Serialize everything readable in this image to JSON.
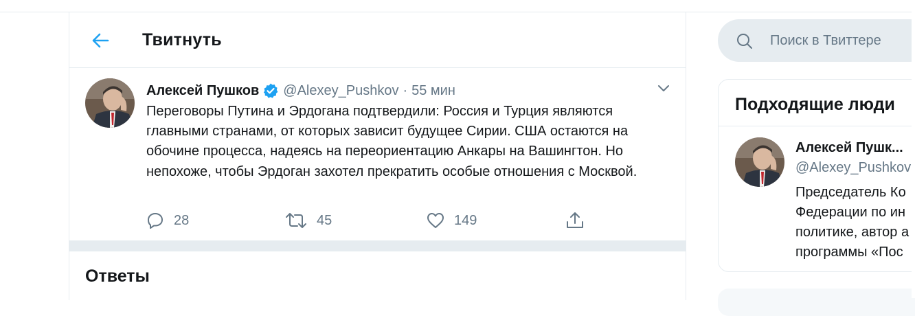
{
  "header": {
    "title": "Твитнуть"
  },
  "tweet": {
    "author_name": "Алексей Пушков",
    "handle": "@Alexey_Pushkov",
    "separator": "·",
    "time": "55 мин",
    "text": "Переговоры Путина и Эрдогана подтвердили: Россия и Турция являются главными странами, от которых зависит будущее Сирии. США остаются на обочине процесса, надеясь на переориентацию Анкары на Вашингтон. Но непохоже, чтобы Эрдоган захотел прекратить особые отношения с Москвой.",
    "replies": "28",
    "retweets": "45",
    "likes": "149"
  },
  "answers": {
    "title": "Ответы"
  },
  "search": {
    "placeholder": "Поиск в Твиттере"
  },
  "suggestions": {
    "title": "Подходящие люди",
    "person": {
      "name": "Алексей Пушк...",
      "handle": "@Alexey_Pushkov",
      "bio": "Председатель Ко\nФедерации по ин\nполитике, автор а\nпрограммы «Пос"
    }
  },
  "colors": {
    "accent": "#1da1f2",
    "muted": "#657786",
    "border": "#e6ecf0",
    "text": "#14171a"
  },
  "icons": [
    "back-arrow-icon",
    "verified-badge-icon",
    "chevron-down-icon",
    "reply-icon",
    "retweet-icon",
    "like-icon",
    "share-icon",
    "search-icon"
  ]
}
